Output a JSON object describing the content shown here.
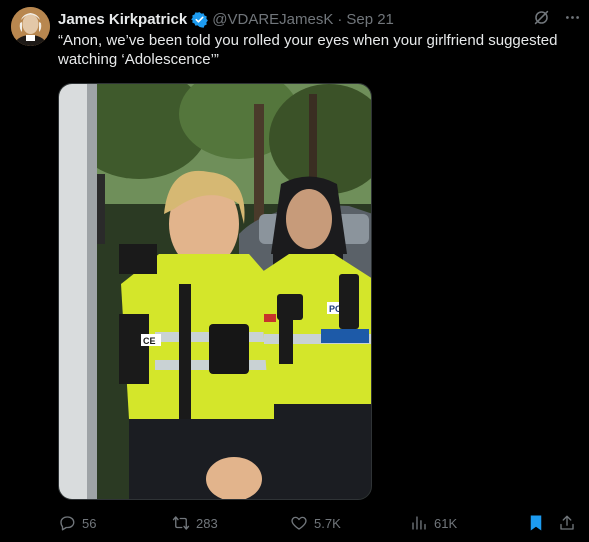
{
  "tweet": {
    "author_name": "James Kirkpatrick",
    "handle": "@VDAREJamesK",
    "separator": "·",
    "date": "Sep 21",
    "text": "“Anon, we’ve been told you rolled your eyes when your girlfriend suggested watching ‘Adolescence’”",
    "verified": true
  },
  "icons": {
    "verified": "verified-badge-icon",
    "grok": "grok-icon",
    "more": "more-icon",
    "reply": "reply-icon",
    "retweet": "retweet-icon",
    "like": "heart-icon",
    "views": "views-icon",
    "bookmark": "bookmark-icon",
    "share": "share-icon"
  },
  "stats": {
    "replies": "56",
    "retweets": "283",
    "likes": "5.7K",
    "views": "61K"
  },
  "media": {
    "badge_left": "CE",
    "badge_right": "PO"
  },
  "colors": {
    "background": "#000000",
    "text": "#e7e9ea",
    "muted": "#71767b",
    "verified": "#1d9bf0",
    "bookmark_active": "#1d9bf0",
    "hi_vis": "#d4e62a"
  }
}
